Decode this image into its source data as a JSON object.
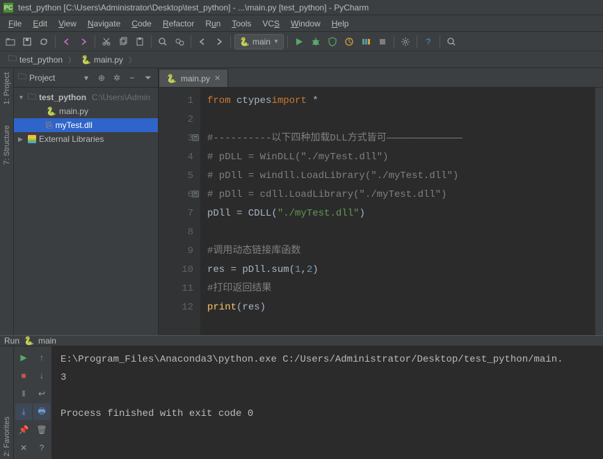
{
  "title": "test_python [C:\\Users\\Administrator\\Desktop\\test_python] - ...\\main.py [test_python] - PyCharm",
  "menu": [
    "File",
    "Edit",
    "View",
    "Navigate",
    "Code",
    "Refactor",
    "Run",
    "Tools",
    "VCS",
    "Window",
    "Help"
  ],
  "run_config": {
    "name": "main"
  },
  "breadcrumb": {
    "root": "test_python",
    "file": "main.py"
  },
  "left_tabs": {
    "project": "1: Project",
    "structure": "7: Structure",
    "favorites": "2: Favorites"
  },
  "project_panel": {
    "title": "Project",
    "root": {
      "name": "test_python",
      "path": "C:\\Users\\Admin"
    },
    "files": [
      "main.py",
      "myTest.dll"
    ],
    "external": "External Libraries"
  },
  "editor": {
    "tab": "main.py",
    "lines": [
      {
        "n": 1,
        "tokens": [
          [
            "kw",
            "from"
          ],
          [
            "",
            "ctypes"
          ],
          [
            "kw",
            "import"
          ],
          [
            "",
            "*"
          ]
        ]
      },
      {
        "n": 2,
        "tokens": []
      },
      {
        "n": 3,
        "fold": true,
        "tokens": [
          [
            "cmt",
            "#----------以下四种加载DLL方式皆可—————————————"
          ]
        ]
      },
      {
        "n": 4,
        "tokens": [
          [
            "cmt",
            "# pDLL = WinDLL(\"./myTest.dll\")"
          ]
        ]
      },
      {
        "n": 5,
        "tokens": [
          [
            "cmt",
            "# pDll = windll.LoadLibrary(\"./myTest.dll\")"
          ]
        ]
      },
      {
        "n": 6,
        "fold": true,
        "tokens": [
          [
            "cmt",
            "# pDll = cdll.LoadLibrary(\"./myTest.dll\")"
          ]
        ]
      },
      {
        "n": 7,
        "tokens": [
          [
            "",
            "pDll = CDLL("
          ],
          [
            "str",
            "\"./myTest.dll\""
          ],
          [
            "",
            ")"
          ]
        ]
      },
      {
        "n": 8,
        "tokens": []
      },
      {
        "n": 9,
        "tokens": [
          [
            "cmt",
            "#调用动态链接库函数"
          ]
        ]
      },
      {
        "n": 10,
        "tokens": [
          [
            "",
            "res = pDll.sum("
          ],
          [
            "num",
            "1"
          ],
          [
            "",
            ","
          ],
          [
            "num",
            "2"
          ],
          [
            "",
            ")"
          ]
        ]
      },
      {
        "n": 11,
        "tokens": [
          [
            "cmt",
            "#打印返回结果"
          ]
        ]
      },
      {
        "n": 12,
        "tokens": [
          [
            "fn",
            "print"
          ],
          [
            "",
            "(res)"
          ]
        ]
      }
    ]
  },
  "run_panel": {
    "label": "Run",
    "config": "main",
    "output": [
      "E:\\Program_Files\\Anaconda3\\python.exe C:/Users/Administrator/Desktop/test_python/main.",
      "3",
      "",
      "Process finished with exit code 0"
    ]
  }
}
